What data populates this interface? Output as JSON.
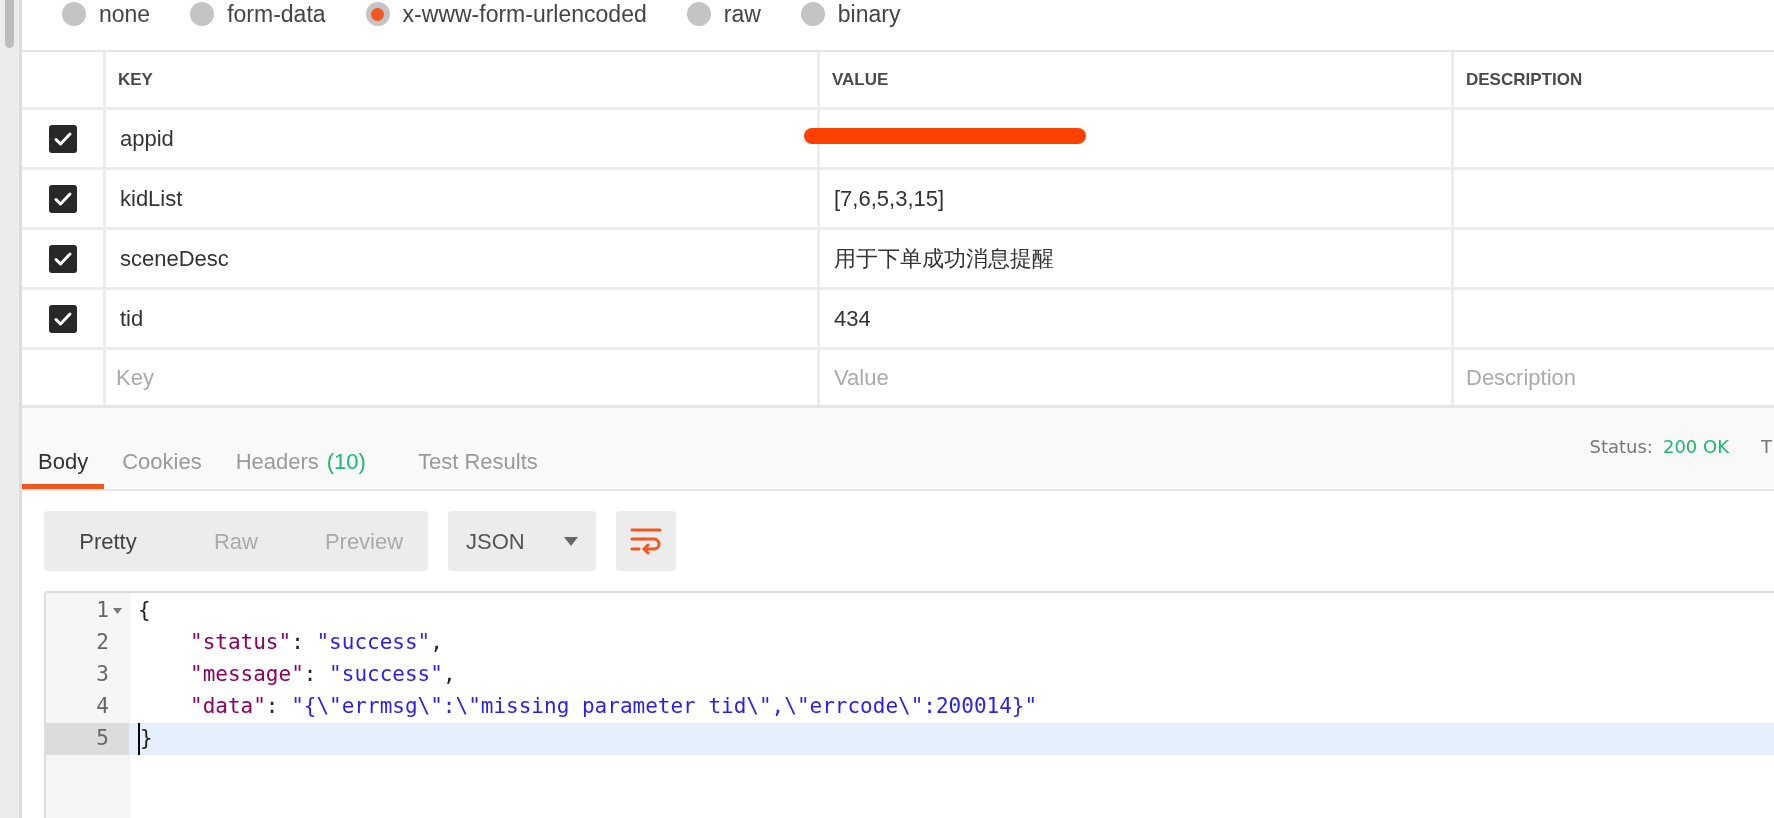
{
  "body_types": [
    {
      "label": "none",
      "selected": false
    },
    {
      "label": "form-data",
      "selected": false
    },
    {
      "label": "x-www-form-urlencoded",
      "selected": true
    },
    {
      "label": "raw",
      "selected": false
    },
    {
      "label": "binary",
      "selected": false
    }
  ],
  "table": {
    "columns": [
      "KEY",
      "VALUE",
      "DESCRIPTION"
    ],
    "rows": [
      {
        "checked": true,
        "key": "appid",
        "value_redacted": true
      },
      {
        "checked": true,
        "key": "kidList",
        "value": "[7,6,5,3,15]"
      },
      {
        "checked": true,
        "key": "sceneDesc",
        "value": "用于下单成功消息提醒"
      },
      {
        "checked": true,
        "key": "tid",
        "value": "434"
      }
    ],
    "new_row": {
      "key_placeholder": "Key",
      "value_placeholder": "Value",
      "description_placeholder": "Description"
    }
  },
  "response_tabs": [
    {
      "label": "Body",
      "selected": true
    },
    {
      "label": "Cookies",
      "selected": false
    },
    {
      "label": "Headers",
      "count": "(10)",
      "selected": false
    },
    {
      "label": "Test Results",
      "selected": false
    }
  ],
  "status": {
    "label": "Status:",
    "value": "200 OK",
    "next_label_cut": "T"
  },
  "view_modes": [
    {
      "label": "Pretty",
      "selected": true
    },
    {
      "label": "Raw",
      "selected": false
    },
    {
      "label": "Preview",
      "selected": false
    }
  ],
  "format_select": {
    "value": "JSON"
  },
  "code": {
    "lines": [
      {
        "number": "1",
        "foldable": true,
        "selected": false,
        "tokens": [
          {
            "kind": "punct",
            "text": "{"
          }
        ]
      },
      {
        "number": "2",
        "foldable": false,
        "selected": false,
        "tokens": [
          {
            "kind": "key",
            "text": "\"status\""
          },
          {
            "kind": "punct",
            "text": ": "
          },
          {
            "kind": "string",
            "text": "\"success\""
          },
          {
            "kind": "punct",
            "text": ","
          }
        ]
      },
      {
        "number": "3",
        "foldable": false,
        "selected": false,
        "tokens": [
          {
            "kind": "key",
            "text": "\"message\""
          },
          {
            "kind": "punct",
            "text": ": "
          },
          {
            "kind": "string",
            "text": "\"success\""
          },
          {
            "kind": "punct",
            "text": ","
          }
        ]
      },
      {
        "number": "4",
        "foldable": false,
        "selected": false,
        "tokens": [
          {
            "kind": "key",
            "text": "\"data\""
          },
          {
            "kind": "punct",
            "text": ": "
          },
          {
            "kind": "string",
            "text": "\"{\\\"errmsg\\\":\\\"missing parameter tid\\\",\\\"errcode\\\":200014}\""
          }
        ]
      },
      {
        "number": "5",
        "foldable": false,
        "selected": true,
        "tokens": [
          {
            "kind": "punct",
            "text": "}"
          }
        ]
      }
    ]
  }
}
